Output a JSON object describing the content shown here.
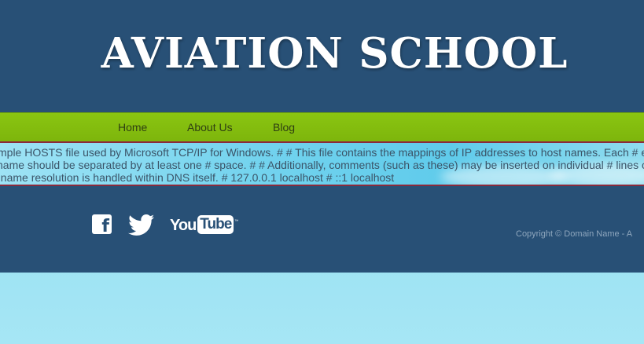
{
  "site": {
    "title": "AVIATION SCHOOL"
  },
  "nav": {
    "items": [
      {
        "label": "Home"
      },
      {
        "label": "About Us"
      },
      {
        "label": "Blog"
      }
    ]
  },
  "content": {
    "lines": [
      "mple HOSTS file used by Microsoft TCP/IP for Windows. # # This file contains the mappings of IP addresses to host names. Each # e",
      "name should be separated by at least one # space. # # Additionally, comments (such as these) may be inserted on individual # lines o",
      "t name resolution is handled within DNS itself. # 127.0.0.1 localhost # ::1 localhost"
    ]
  },
  "social": {
    "facebook_glyph": "f",
    "youtube_you": "You",
    "youtube_tube": "Tube",
    "youtube_tm": "™",
    "icons": [
      "facebook-icon",
      "twitter-icon",
      "youtube-icon"
    ]
  },
  "footer": {
    "copyright": "Copyright © Domain Name - A"
  },
  "colors": {
    "header_bg": "#285076",
    "nav_bg": "#82bd0f",
    "strip_border": "#8b2a3c",
    "sky": "#8fdcef"
  }
}
